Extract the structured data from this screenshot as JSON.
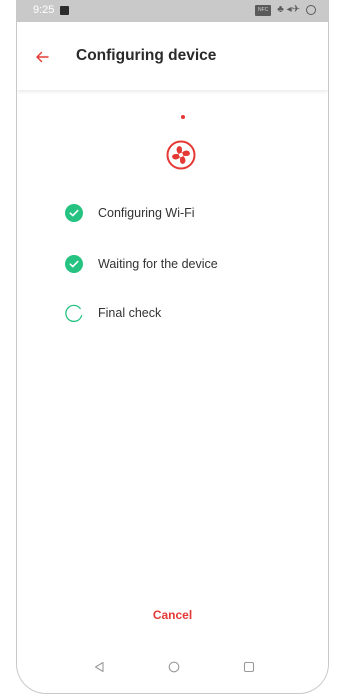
{
  "status_bar": {
    "time": "9:25",
    "badge": "NFC",
    "right_glyphs": "♣ ◂✈"
  },
  "app_bar": {
    "title": "Configuring device",
    "back_icon": "arrow-left-icon"
  },
  "steps": [
    {
      "label": "Configuring Wi-Fi",
      "state": "done"
    },
    {
      "label": "Waiting for the device",
      "state": "done"
    },
    {
      "label": "Final check",
      "state": "in-progress"
    }
  ],
  "cancel_label": "Cancel",
  "colors": {
    "accent": "#e53935",
    "success": "#26c281",
    "status_bar": "#c9c9c9",
    "title_text": "#2a2a2a"
  }
}
